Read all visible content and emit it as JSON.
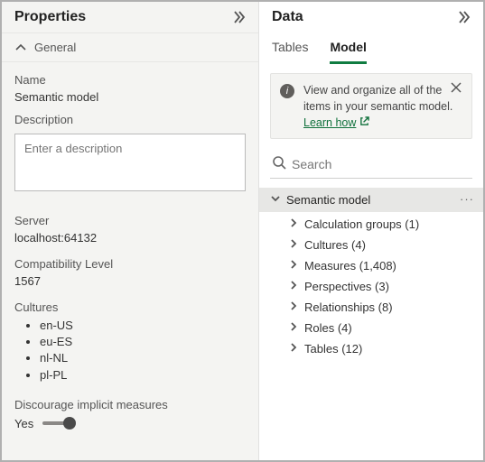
{
  "properties": {
    "title": "Properties",
    "general_label": "General",
    "name_label": "Name",
    "name_value": "Semantic model",
    "description_label": "Description",
    "description_placeholder": "Enter a description",
    "server_label": "Server",
    "server_value": "localhost:64132",
    "compat_label": "Compatibility Level",
    "compat_value": "1567",
    "cultures_label": "Cultures",
    "cultures": [
      "en-US",
      "eu-ES",
      "nl-NL",
      "pl-PL"
    ],
    "discourage_label": "Discourage implicit measures",
    "discourage_value": "Yes"
  },
  "data": {
    "title": "Data",
    "tabs": {
      "tables": "Tables",
      "model": "Model"
    },
    "info_text": "View and organize all of the items in your semantic model.",
    "info_link": "Learn how",
    "search_placeholder": "Search",
    "tree_root": "Semantic model",
    "tree_items": [
      "Calculation groups (1)",
      "Cultures (4)",
      "Measures (1,408)",
      "Perspectives (3)",
      "Relationships (8)",
      "Roles (4)",
      "Tables (12)"
    ]
  }
}
